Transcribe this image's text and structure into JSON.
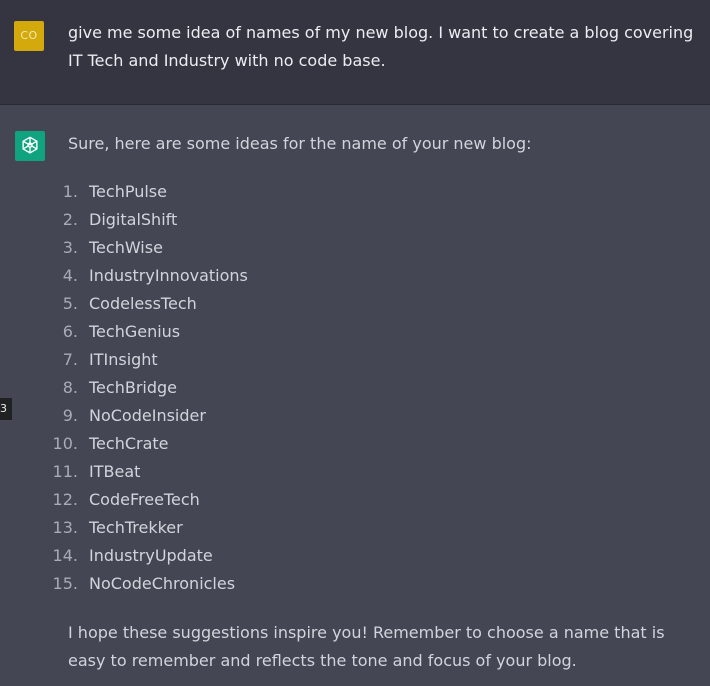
{
  "user_message": {
    "avatar_initials": "CO",
    "avatar_color": "#d4a90b",
    "text": "give me some idea of names of my new blog. I want to create a blog covering IT Tech and Industry with no code base."
  },
  "assistant_message": {
    "avatar_icon": "openai-logo-icon",
    "avatar_color": "#10a37f",
    "intro": "Sure, here are some ideas for the name of your new blog:",
    "names": [
      {
        "num": "1.",
        "name": "TechPulse"
      },
      {
        "num": "2.",
        "name": "DigitalShift"
      },
      {
        "num": "3.",
        "name": "TechWise"
      },
      {
        "num": "4.",
        "name": "IndustryInnovations"
      },
      {
        "num": "5.",
        "name": "CodelessTech"
      },
      {
        "num": "6.",
        "name": "TechGenius"
      },
      {
        "num": "7.",
        "name": "ITInsight"
      },
      {
        "num": "8.",
        "name": "TechBridge"
      },
      {
        "num": "9.",
        "name": "NoCodeInsider"
      },
      {
        "num": "10.",
        "name": "TechCrate"
      },
      {
        "num": "11.",
        "name": "ITBeat"
      },
      {
        "num": "12.",
        "name": "CodeFreeTech"
      },
      {
        "num": "13.",
        "name": "TechTrekker"
      },
      {
        "num": "14.",
        "name": "IndustryUpdate"
      },
      {
        "num": "15.",
        "name": "NoCodeChronicles"
      }
    ],
    "outro": "I hope these suggestions inspire you! Remember to choose a name that is easy to remember and reflects the tone and focus of your blog."
  },
  "side_tab": {
    "label": "3"
  }
}
